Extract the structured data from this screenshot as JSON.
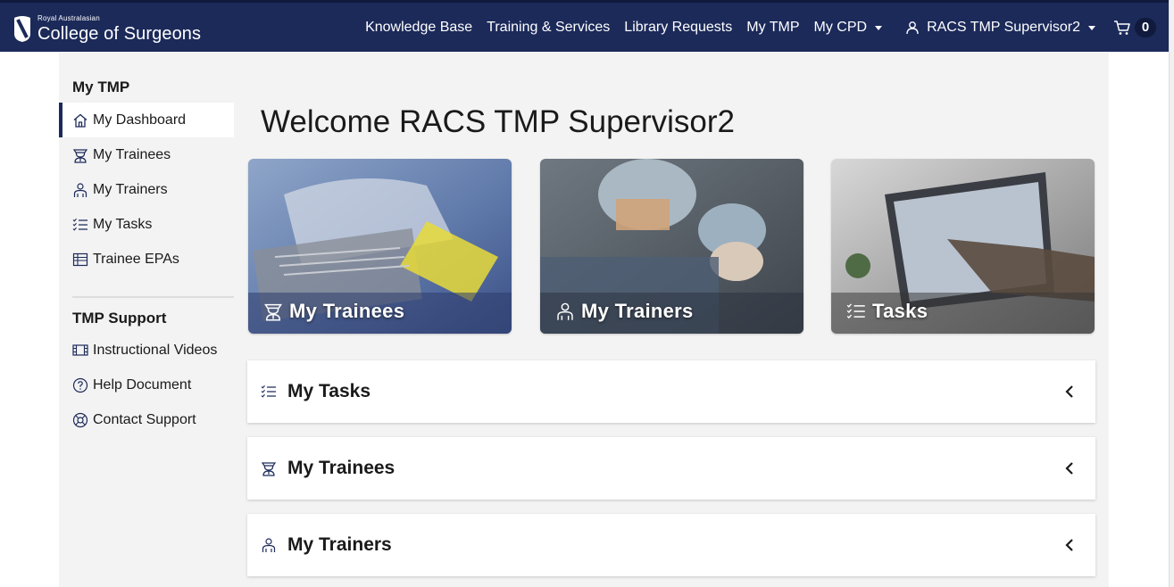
{
  "brand": {
    "small": "Royal Australasian",
    "big": "College of Surgeons"
  },
  "nav": {
    "links": [
      "Knowledge Base",
      "Training & Services",
      "Library Requests",
      "My TMP",
      "My CPD"
    ],
    "user": "RACS TMP Supervisor2",
    "cart_count": "0"
  },
  "sidebar": {
    "section1": "My TMP",
    "items1": [
      {
        "label": "My Dashboard",
        "icon": "home-icon"
      },
      {
        "label": "My Trainees",
        "icon": "graduate-icon"
      },
      {
        "label": "My Trainers",
        "icon": "trainer-icon"
      },
      {
        "label": "My Tasks",
        "icon": "task-list-icon"
      },
      {
        "label": "Trainee EPAs",
        "icon": "table-icon"
      }
    ],
    "section2": "TMP Support",
    "items2": [
      {
        "label": "Instructional Videos",
        "icon": "film-icon"
      },
      {
        "label": "Help Document",
        "icon": "help-icon"
      },
      {
        "label": "Contact Support",
        "icon": "headset-icon"
      }
    ]
  },
  "main": {
    "welcome": "Welcome RACS TMP Supervisor2",
    "cards": [
      {
        "label": "My Trainees",
        "icon": "graduate-icon"
      },
      {
        "label": "My Trainers",
        "icon": "trainer-icon"
      },
      {
        "label": "Tasks",
        "icon": "task-list-icon"
      }
    ],
    "panels": [
      {
        "title": "My Tasks",
        "icon": "task-list-icon"
      },
      {
        "title": "My Trainees",
        "icon": "graduate-icon"
      },
      {
        "title": "My Trainers",
        "icon": "trainer-icon"
      }
    ]
  },
  "colors": {
    "nav_bg": "#1c2a5a",
    "page_bg": "#f3f3f3",
    "active_border": "#1c2a5a"
  }
}
